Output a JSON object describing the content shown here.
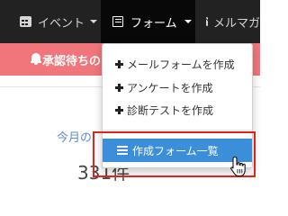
{
  "navbar": {
    "items": [
      {
        "label": "イベント",
        "icon": "calendar-icon"
      },
      {
        "label": "フォーム",
        "icon": "list-alt-icon",
        "active": true
      },
      {
        "label": "メルマガ",
        "icon": "envelope-icon"
      }
    ]
  },
  "alert": {
    "text": "承認待ちの",
    "icon": "bell-icon",
    "color": "#f0767b"
  },
  "stat": {
    "label": "今月の",
    "value": "331件"
  },
  "dropdown": {
    "items": [
      {
        "label": "メールフォームを作成",
        "icon": "plus-icon"
      },
      {
        "label": "アンケートを作成",
        "icon": "plus-icon"
      },
      {
        "label": "診断テストを作成",
        "icon": "plus-icon"
      }
    ],
    "active_item": {
      "label": "作成フォーム一覧",
      "icon": "list-icon"
    }
  },
  "colors": {
    "navbar": "#222222",
    "active_item": "#3b8fd9",
    "highlight": "#e2231a"
  }
}
